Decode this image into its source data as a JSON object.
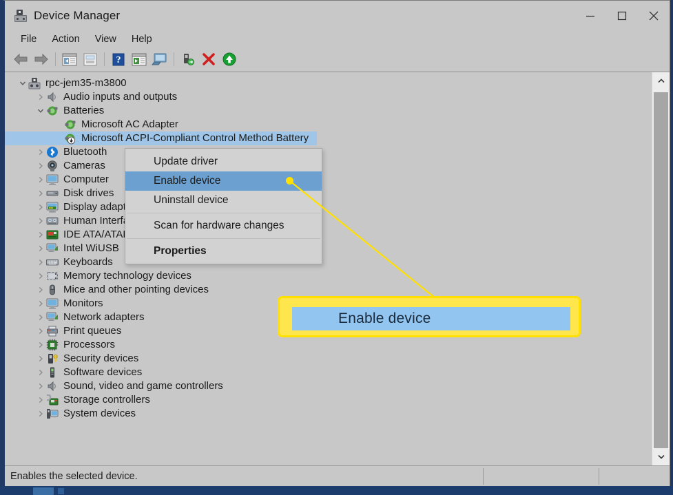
{
  "window": {
    "title": "Device Manager",
    "icon": "device-manager-icon",
    "controls": [
      {
        "name": "minimize-button",
        "glyph": "minimize"
      },
      {
        "name": "maximize-button",
        "glyph": "maximize"
      },
      {
        "name": "close-button",
        "glyph": "close"
      }
    ]
  },
  "menubar": {
    "items": [
      {
        "label": "File"
      },
      {
        "label": "Action"
      },
      {
        "label": "View"
      },
      {
        "label": "Help"
      }
    ]
  },
  "toolbar": {
    "buttons": [
      {
        "name": "back-icon",
        "title": "Back"
      },
      {
        "name": "forward-icon",
        "title": "Forward"
      },
      {
        "name": "separator",
        "title": ""
      },
      {
        "name": "show-hide-console-tree-icon",
        "title": "Show/Hide Console Tree"
      },
      {
        "name": "properties-icon",
        "title": "Properties"
      },
      {
        "name": "separator",
        "title": ""
      },
      {
        "name": "help-icon",
        "title": "Help"
      },
      {
        "name": "show-hide-action-pane-icon",
        "title": "Show/Hide Action Pane"
      },
      {
        "name": "scan-for-hardware-changes-icon",
        "title": "Scan for hardware changes"
      },
      {
        "name": "separator",
        "title": ""
      },
      {
        "name": "update-driver-icon",
        "title": "Update driver"
      },
      {
        "name": "uninstall-device-icon",
        "title": "Uninstall device"
      },
      {
        "name": "enable-device-icon",
        "title": "Enable device"
      }
    ]
  },
  "tree": {
    "nodes": [
      {
        "label": "rpc-jem35-m3800",
        "indent": 0,
        "twisty": "expanded",
        "icon": "computer-root-icon",
        "selected": false,
        "clipped": false
      },
      {
        "label": "Audio inputs and outputs",
        "indent": 1,
        "twisty": "collapsed",
        "icon": "speaker-icon",
        "selected": false,
        "clipped": false
      },
      {
        "label": "Batteries",
        "indent": 1,
        "twisty": "expanded",
        "icon": "battery-icon",
        "selected": false,
        "clipped": false
      },
      {
        "label": "Microsoft AC Adapter",
        "indent": 2,
        "twisty": "none",
        "icon": "battery-icon",
        "selected": false,
        "clipped": false
      },
      {
        "label": "Microsoft ACPI-Compliant Control Method Battery",
        "indent": 2,
        "twisty": "none",
        "icon": "battery-disabled-icon",
        "selected": true,
        "clipped": false
      },
      {
        "label": "Bluetooth",
        "indent": 1,
        "twisty": "collapsed",
        "icon": "bluetooth-icon",
        "selected": false,
        "clipped": false
      },
      {
        "label": "Cameras",
        "indent": 1,
        "twisty": "collapsed",
        "icon": "camera-icon",
        "selected": false,
        "clipped": false
      },
      {
        "label": "Computer",
        "indent": 1,
        "twisty": "collapsed",
        "icon": "monitor-icon",
        "selected": false,
        "clipped": false
      },
      {
        "label": "Disk drives",
        "indent": 1,
        "twisty": "collapsed",
        "icon": "disk-drive-icon",
        "selected": false,
        "clipped": false
      },
      {
        "label": "Display adapters",
        "indent": 1,
        "twisty": "collapsed",
        "icon": "display-adapter-icon",
        "selected": false,
        "clipped": true
      },
      {
        "label": "Human Interface Devices",
        "indent": 1,
        "twisty": "collapsed",
        "icon": "hid-icon",
        "selected": false,
        "clipped": true
      },
      {
        "label": "IDE ATA/ATAPI controllers",
        "indent": 1,
        "twisty": "collapsed",
        "icon": "ide-controller-icon",
        "selected": false,
        "clipped": true
      },
      {
        "label": "Intel WiUSB",
        "indent": 1,
        "twisty": "collapsed",
        "icon": "network-adapter-icon",
        "selected": false,
        "clipped": false
      },
      {
        "label": "Keyboards",
        "indent": 1,
        "twisty": "collapsed",
        "icon": "keyboard-icon",
        "selected": false,
        "clipped": false
      },
      {
        "label": "Memory technology devices",
        "indent": 1,
        "twisty": "collapsed",
        "icon": "memory-icon",
        "selected": false,
        "clipped": false
      },
      {
        "label": "Mice and other pointing devices",
        "indent": 1,
        "twisty": "collapsed",
        "icon": "mouse-icon",
        "selected": false,
        "clipped": false
      },
      {
        "label": "Monitors",
        "indent": 1,
        "twisty": "collapsed",
        "icon": "monitor-icon",
        "selected": false,
        "clipped": false
      },
      {
        "label": "Network adapters",
        "indent": 1,
        "twisty": "collapsed",
        "icon": "network-adapter-icon",
        "selected": false,
        "clipped": false
      },
      {
        "label": "Print queues",
        "indent": 1,
        "twisty": "collapsed",
        "icon": "printer-icon",
        "selected": false,
        "clipped": false
      },
      {
        "label": "Processors",
        "indent": 1,
        "twisty": "collapsed",
        "icon": "processor-icon",
        "selected": false,
        "clipped": false
      },
      {
        "label": "Security devices",
        "indent": 1,
        "twisty": "collapsed",
        "icon": "security-device-icon",
        "selected": false,
        "clipped": false
      },
      {
        "label": "Software devices",
        "indent": 1,
        "twisty": "collapsed",
        "icon": "software-device-icon",
        "selected": false,
        "clipped": false
      },
      {
        "label": "Sound, video and game controllers",
        "indent": 1,
        "twisty": "collapsed",
        "icon": "speaker-icon",
        "selected": false,
        "clipped": false
      },
      {
        "label": "Storage controllers",
        "indent": 1,
        "twisty": "collapsed",
        "icon": "storage-controller-icon",
        "selected": false,
        "clipped": false
      },
      {
        "label": "System devices",
        "indent": 1,
        "twisty": "collapsed",
        "icon": "system-device-icon",
        "selected": false,
        "clipped": false
      }
    ]
  },
  "context_menu": {
    "items": [
      {
        "label": "Update driver",
        "highlighted": false,
        "bold": false,
        "separator_after": false
      },
      {
        "label": "Enable device",
        "highlighted": true,
        "bold": false,
        "separator_after": false
      },
      {
        "label": "Uninstall device",
        "highlighted": false,
        "bold": false,
        "separator_after": true
      },
      {
        "label": "Scan for hardware changes",
        "highlighted": false,
        "bold": false,
        "separator_after": true
      },
      {
        "label": "Properties",
        "highlighted": false,
        "bold": true,
        "separator_after": false
      }
    ]
  },
  "callout": {
    "label": "Enable device",
    "border_color": "#ffe000",
    "fill_color": "#ffe64d",
    "item_color": "#92c5f0"
  },
  "statusbar": {
    "text": "Enables the selected device."
  },
  "colors": {
    "window_bg": "#c8c8c8",
    "selection": "#9fc6e8",
    "menu_highlight": "#6ca0d0",
    "menu_bg": "#d2d2d2",
    "accent_yellow": "#ffe000"
  }
}
